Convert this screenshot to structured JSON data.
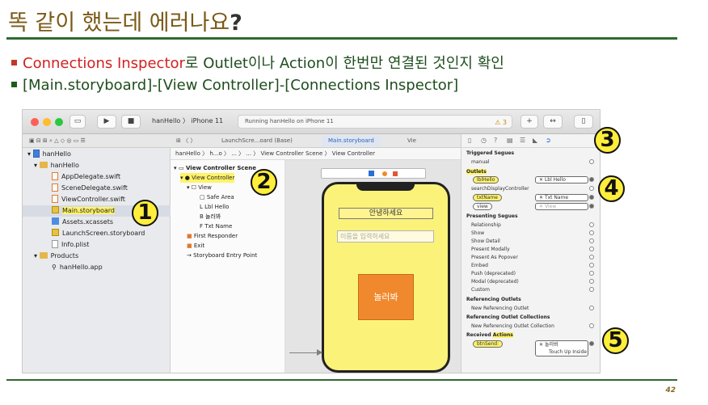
{
  "slide": {
    "title": "똑 같이 했는데 에러나요",
    "title_q": "?",
    "bullet1_red": "Connections Inspector",
    "bullet1_rest_a": "로 ",
    "bullet1_outlet": "Outlet",
    "bullet1_rest_b": "이나 ",
    "bullet1_action": "Action",
    "bullet1_rest_c": "이 한번만 연결된 것인지 확인",
    "bullet2": "[Main.storyboard]-[View Controller]-[Connections Inspector]",
    "page_number": "42"
  },
  "xcode": {
    "scheme_project": "hanHello",
    "scheme_device": "iPhone 11",
    "status_text": "Running hanHello on iPhone 11",
    "warning_count": "3",
    "tabs": [
      "LaunchScre...oard (Base)",
      "Main.storyboard",
      "Vie"
    ],
    "jumpbar": "hanHello 〉 h...o 〉 ... 〉 ... 〉 View Controller Scene 〉 View Controller",
    "navigator": {
      "project": "hanHello",
      "group": "hanHello",
      "files": [
        "AppDelegate.swift",
        "SceneDelegate.swift",
        "ViewController.swift",
        "Main.storyboard",
        "Assets.xcassets",
        "LaunchScreen.storyboard",
        "Info.plist"
      ],
      "products_group": "Products",
      "product_app": "hanHello.app"
    },
    "outline": {
      "scene": "View Controller Scene",
      "controller": "View Controller",
      "view": "View",
      "safe_area": "Safe Area",
      "lbl": "Lbl Hello",
      "btn": "놀러봐",
      "txt": "Txt Name",
      "first_responder": "First Responder",
      "exit": "Exit",
      "entry": "Storyboard Entry Point"
    },
    "canvas": {
      "label_text": "안녕하세요",
      "placeholder": "이름을 입력하세요",
      "button_text": "놀러봐"
    },
    "inspector": {
      "triggered_header": "Triggered Segues",
      "manual": "manual",
      "outlets_header": "Outlets",
      "outlets": [
        {
          "name": "lblHello",
          "target": "Lbl Hello",
          "connected": true
        },
        {
          "name": "searchDisplayController",
          "target": "",
          "connected": false
        },
        {
          "name": "txtName",
          "target": "Txt Name",
          "connected": true
        },
        {
          "name": "view",
          "target": "View",
          "connected": true
        }
      ],
      "presenting_header": "Presenting Segues",
      "presenting": [
        "Relationship",
        "Show",
        "Show Detail",
        "Present Modally",
        "Present As Popover",
        "Embed",
        "Push (deprecated)",
        "Modal (deprecated)",
        "Custom"
      ],
      "ref_outlets_header": "Referencing Outlets",
      "new_ref_outlet": "New Referencing Outlet",
      "ref_collections_header": "Referencing Outlet Collections",
      "new_ref_collection": "New Referencing Outlet Collection",
      "received_header_a": "Received ",
      "received_header_b": "Actions",
      "action_name": "btnSend:",
      "action_target": "놀러봐",
      "action_event": "Touch Up Inside"
    }
  },
  "badges": [
    "1",
    "2",
    "3",
    "4",
    "5"
  ],
  "colors": {
    "title": "#7a5a17",
    "rule": "#2f6a2f",
    "highlight": "#fff36a",
    "badge": "#ffee3b",
    "accent_red": "#d42020",
    "phone_bg": "#fbf27a",
    "button_bg": "#f0892d"
  }
}
